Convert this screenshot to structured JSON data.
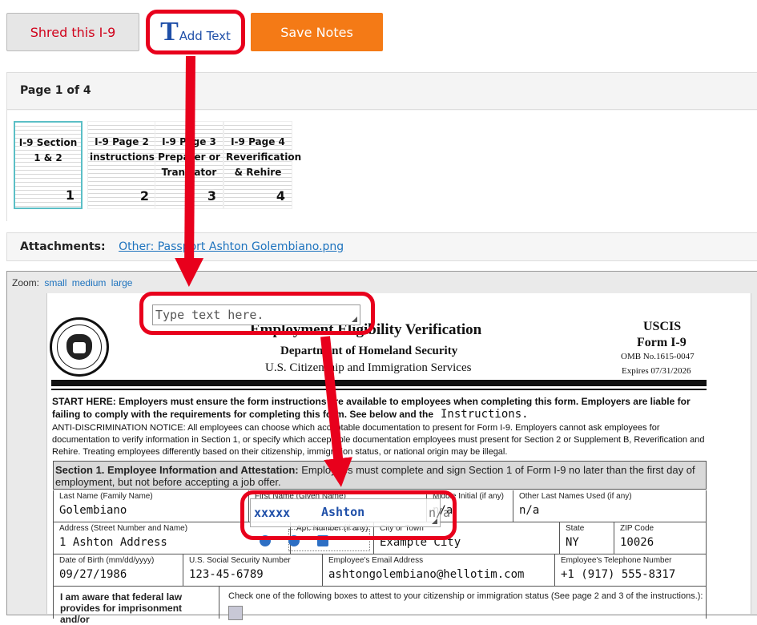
{
  "toolbar": {
    "shred_label": "Shred this I-9",
    "add_text_glyph": "T",
    "add_text_label": "Add Text",
    "save_notes_label": "Save Notes"
  },
  "pages": {
    "header": "Page 1 of 4",
    "thumbs": [
      {
        "title": "I-9 Section 1 & 2",
        "number": "1",
        "selected": true
      },
      {
        "title": "I-9 Page 2 instructions",
        "number": "2",
        "selected": false
      },
      {
        "title": "I-9 Page 3 Preparer or Translator",
        "number": "3",
        "selected": false
      },
      {
        "title": "I-9 Page 4 Reverification & Rehire",
        "number": "4",
        "selected": false
      }
    ]
  },
  "attachments": {
    "label": "Attachments:",
    "link": "Other: Passport Ashton Golembiano.png"
  },
  "zoom": {
    "label": "Zoom:",
    "options": [
      "small",
      "medium",
      "large"
    ]
  },
  "overlay": {
    "textbox_placeholder": "Type text here.",
    "instructions_text": "Instructions.",
    "xxxxx": "xxxxx",
    "ashton": "Ashton",
    "na_small": "n/a"
  },
  "document": {
    "title": "Employment Eligibility Verification",
    "department": "Department of Homeland Security",
    "agency": "U.S. Citizenship and Immigration Services",
    "uscis": "USCIS",
    "form": "Form I-9",
    "omb": "OMB No.1615-0047",
    "expires": "Expires 07/31/2026",
    "start_here": "START HERE:  Employers must ensure the form instructions are available to employees when completing this form.  Employers are liable for failing to comply with the requirements for completing this form.  See below and the",
    "anti_discrimination": "ANTI-DISCRIMINATION NOTICE:  All employees can choose which acceptable documentation to present for Form I-9.  Employers cannot ask employees for documentation to verify information in Section 1, or specify which acceptable documentation employees must present for Section 2 or Supplement B, Reverification and Rehire.  Treating employees differently based on their citizenship, immigration status, or national origin may be illegal.",
    "section1_title": "Section 1. Employee Information and Attestation:",
    "section1_text": " Employees must complete and sign Section 1 of Form I-9 no later than the first day of employment, but not before accepting a job offer.",
    "fields": {
      "last_name_label": "Last Name (Family Name)",
      "last_name": "Golembiano",
      "first_name_label": "First Name (Given Name)",
      "middle_label": "Middle Initial (if any)",
      "middle": "n/a",
      "other_names_label": "Other Last Names Used (if any)",
      "other_names": "n/a",
      "address_label": "Address (Street Number and Name)",
      "address": "1 Ashton Address",
      "apt_label": "Apt. Number (if any)",
      "city_label": "City or Town",
      "city": "Example City",
      "state_label": "State",
      "state": "NY",
      "zip_label": "ZIP Code",
      "zip": "10026",
      "dob_label": "Date of Birth (mm/dd/yyyy)",
      "dob": "09/27/1986",
      "ssn_label": "U.S. Social Security Number",
      "ssn": "123-45-6789",
      "email_label": "Employee's Email Address",
      "email": "ashtongolembiano@hellotim.com",
      "phone_label": "Employee's Telephone Number",
      "phone": "+1 (917) 555-8317"
    },
    "attest_left": "I am aware that federal law provides for imprisonment and/or",
    "attest_right": "Check one of the following boxes to attest to your citizenship or immigration status (See page 2 and 3 of the instructions.):"
  },
  "colors": {
    "highlight_red": "#e8001c",
    "save_orange": "#f47a16",
    "link_blue": "#1e73be",
    "text_blue": "#1f4fa8"
  }
}
